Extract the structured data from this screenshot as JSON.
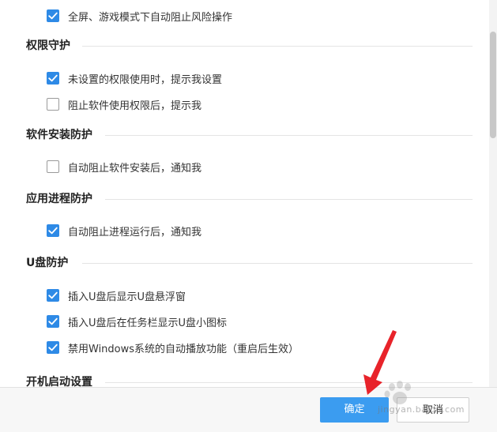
{
  "sections": {
    "top": {
      "items": [
        {
          "label": "全屏、游戏模式下自动阻止风险操作",
          "checked": true
        }
      ]
    },
    "permission": {
      "title": "权限守护",
      "items": [
        {
          "label": "未设置的权限使用时，提示我设置",
          "checked": true
        },
        {
          "label": "阻止软件使用权限后，提示我",
          "checked": false
        }
      ]
    },
    "install": {
      "title": "软件安装防护",
      "items": [
        {
          "label": "自动阻止软件安装后，通知我",
          "checked": false
        }
      ]
    },
    "process": {
      "title": "应用进程防护",
      "items": [
        {
          "label": "自动阻止进程运行后，通知我",
          "checked": true
        }
      ]
    },
    "usb": {
      "title": "U盘防护",
      "items": [
        {
          "label": "插入U盘后显示U盘悬浮窗",
          "checked": true
        },
        {
          "label": "插入U盘后在任务栏显示U盘小图标",
          "checked": true
        },
        {
          "label": "禁用Windows系统的自动播放功能（重启后生效）",
          "checked": true
        }
      ]
    },
    "startup": {
      "title": "开机启动设置"
    }
  },
  "footer": {
    "ok_label": "确定",
    "cancel_label": "取消"
  },
  "watermark": {
    "text": "jingyan.baidu.com"
  },
  "colors": {
    "accent": "#2e8ae6",
    "ok_button": "#3b9cf0",
    "arrow": "#e8232a"
  },
  "icons": {
    "checked": "check-icon",
    "pointer": "red-arrow-icon",
    "watermark": "baidu-paw-icon"
  }
}
